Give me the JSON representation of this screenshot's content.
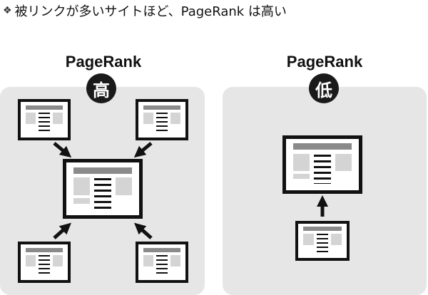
{
  "caption": {
    "bullet": "❖",
    "text": "被リンクが多いサイトほど、PageRank は高い"
  },
  "left_panel": {
    "title": "PageRank",
    "level": "高"
  },
  "right_panel": {
    "title": "PageRank",
    "level": "低"
  },
  "colors": {
    "panel_bg": "#e6e6e6",
    "ink": "#111111",
    "header_bar": "#8a8a8a",
    "sidebar": "#d4d4d4"
  }
}
